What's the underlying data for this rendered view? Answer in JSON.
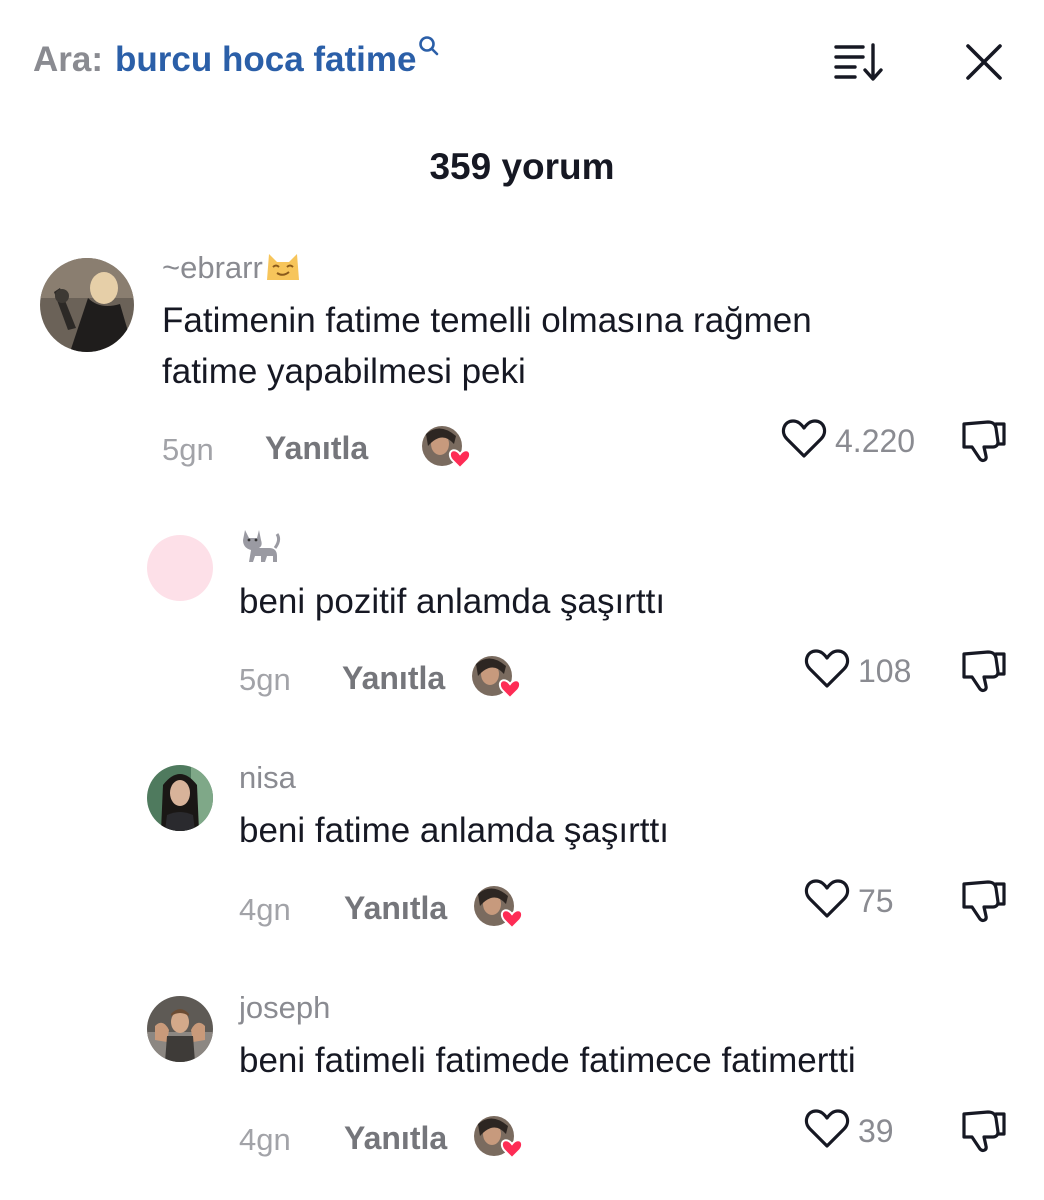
{
  "search": {
    "prefix": "Ara:",
    "query": "burcu hoca fatime"
  },
  "header": {
    "count_title": "359 yorum"
  },
  "colors": {
    "accent_blue": "#2b5fa8",
    "text_primary": "#161823",
    "text_secondary": "#8a8b91",
    "heart_red": "#fe2c55"
  },
  "comments": [
    {
      "username": "~ebrarr",
      "username_emoji": "smirking-cat-emoji",
      "text_line1": "Fatimenin fatime temelli olmasına rağmen",
      "text_line2": "fatime yapabilmesi peki",
      "time": "5gn",
      "reply_label": "Yanıtla",
      "likes": "4.220"
    },
    {
      "username": "",
      "username_emoji": "cat-emoji",
      "text_line1": "beni pozitif anlamda şaşırttı",
      "time": "5gn",
      "reply_label": "Yanıtla",
      "likes": "108"
    },
    {
      "username": "nisa",
      "text_line1": "beni fatime anlamda şaşırttı",
      "time": "4gn",
      "reply_label": "Yanıtla",
      "likes": "75"
    },
    {
      "username": "joseph",
      "text_line1": "beni fatimeli fatimede fatimece fatimertti",
      "time": "4gn",
      "reply_label": "Yanıtla",
      "likes": "39"
    }
  ]
}
